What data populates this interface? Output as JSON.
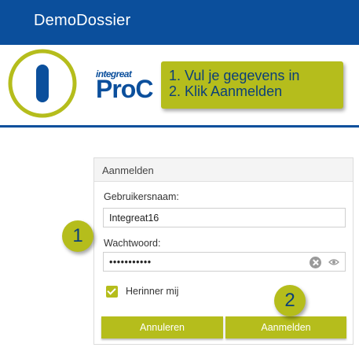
{
  "app": {
    "title": "DemoDossier"
  },
  "brand": {
    "small": "integreat",
    "big": "ProC"
  },
  "callout": {
    "line1": "1. Vul je gegevens in",
    "line2": "2. Klik Aanmelden"
  },
  "login": {
    "header": "Aanmelden",
    "username_label": "Gebruikersnaam:",
    "username_value": "Integreat16",
    "password_label": "Wachtwoord:",
    "password_value": "•••••••••••",
    "remember_label": "Herinner mij",
    "remember_checked": true,
    "cancel_label": "Annuleren",
    "submit_label": "Aanmelden"
  },
  "steps": {
    "one": "1",
    "two": "2"
  },
  "colors": {
    "primary": "#0b4f9c",
    "accent": "#b5bd1c",
    "callout_text": "#0b3f7a"
  },
  "icons": {
    "logo": "integreat-logo-icon",
    "clear": "clear-icon",
    "show_password": "eye-icon",
    "checkbox": "checkmark-icon"
  }
}
